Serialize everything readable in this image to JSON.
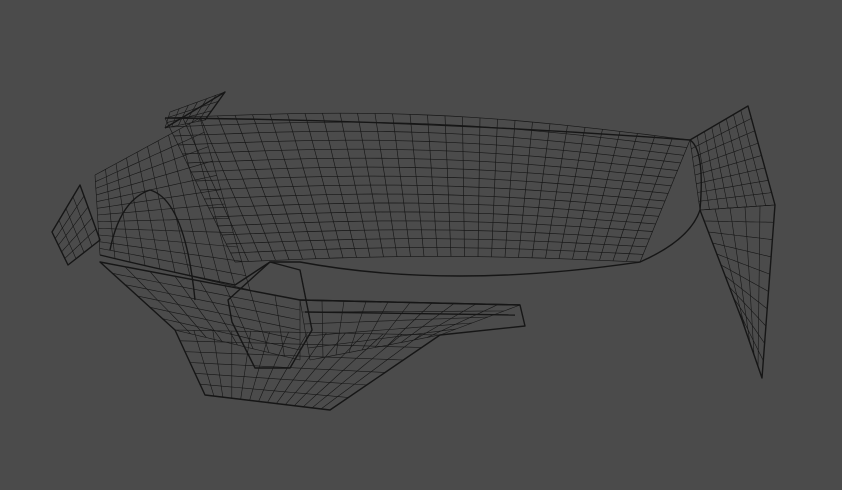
{
  "viewport": {
    "background_color": "#4b4b4b",
    "wire_color": "#161616",
    "display_mode": "wireframe",
    "model": "car-front-body-shell"
  }
}
